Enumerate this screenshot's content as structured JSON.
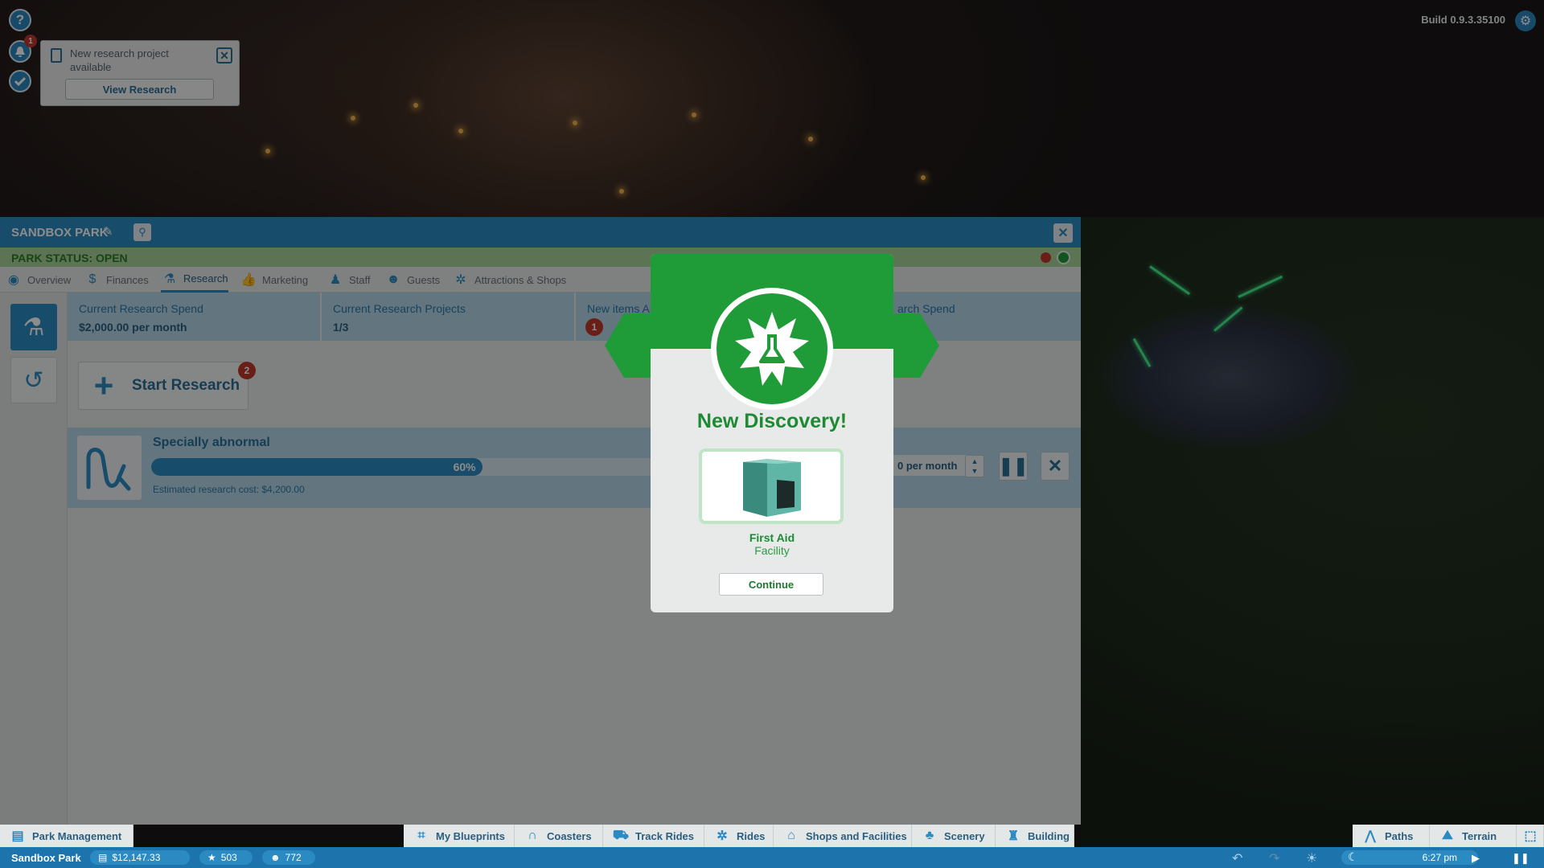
{
  "hud": {
    "help_icon": "question-icon",
    "notification_count": "1",
    "build_label": "Build 0.9.3.35100"
  },
  "toast": {
    "message": "New research project available",
    "button_label": "View Research"
  },
  "panel": {
    "title": "SANDBOX PARK",
    "status": "PARK STATUS: OPEN",
    "tabs": [
      {
        "label": "Overview",
        "icon": "eye-icon"
      },
      {
        "label": "Finances",
        "icon": "dollar-icon"
      },
      {
        "label": "Research",
        "icon": "flask-icon",
        "active": true
      },
      {
        "label": "Marketing",
        "icon": "thumbs-up-icon"
      },
      {
        "label": "Staff",
        "icon": "staff-icon"
      },
      {
        "label": "Guests",
        "icon": "guests-icon"
      },
      {
        "label": "Attractions & Shops",
        "icon": "ferris-wheel-icon"
      }
    ],
    "stats": [
      {
        "label": "Current Research Spend",
        "value": "$2,000.00 per month"
      },
      {
        "label": "Current Research Projects",
        "value": "1/3"
      },
      {
        "label": "New items A",
        "badge": "1"
      },
      {
        "label": "arch Spend",
        "value": ""
      }
    ],
    "start_research": {
      "label": "Start Research",
      "badge": "2"
    },
    "project": {
      "name": "Specially abnormal",
      "progress": 0.6,
      "progress_label": "60%",
      "cost": "Estimated research cost: $4,200.00",
      "spend": "0 per month"
    }
  },
  "modal": {
    "title": "New Discovery!",
    "item_name": "First Aid",
    "item_type": "Facility",
    "continue_label": "Continue"
  },
  "toolbar": {
    "park_management": "Park Management",
    "items": [
      {
        "label": "My Blueprints",
        "icon": "blueprint-icon"
      },
      {
        "label": "Coasters",
        "icon": "coaster-icon"
      },
      {
        "label": "Track Rides",
        "icon": "track-ride-icon"
      },
      {
        "label": "Rides",
        "icon": "ride-icon"
      },
      {
        "label": "Shops and Facilities",
        "icon": "shop-icon"
      },
      {
        "label": "Scenery",
        "icon": "tree-icon"
      },
      {
        "label": "Building",
        "icon": "tower-icon"
      }
    ],
    "right_items": [
      {
        "label": "Paths",
        "icon": "path-icon"
      },
      {
        "label": "Terrain",
        "icon": "terrain-icon"
      }
    ]
  },
  "statusbar": {
    "park_name": "Sandbox Park",
    "money": "$12,147.33",
    "rating": "503",
    "guests": "772",
    "time": "6:27 pm"
  },
  "colors": {
    "accent": "#2b8ac2",
    "success": "#1f9b38",
    "alert": "#c0392b"
  }
}
